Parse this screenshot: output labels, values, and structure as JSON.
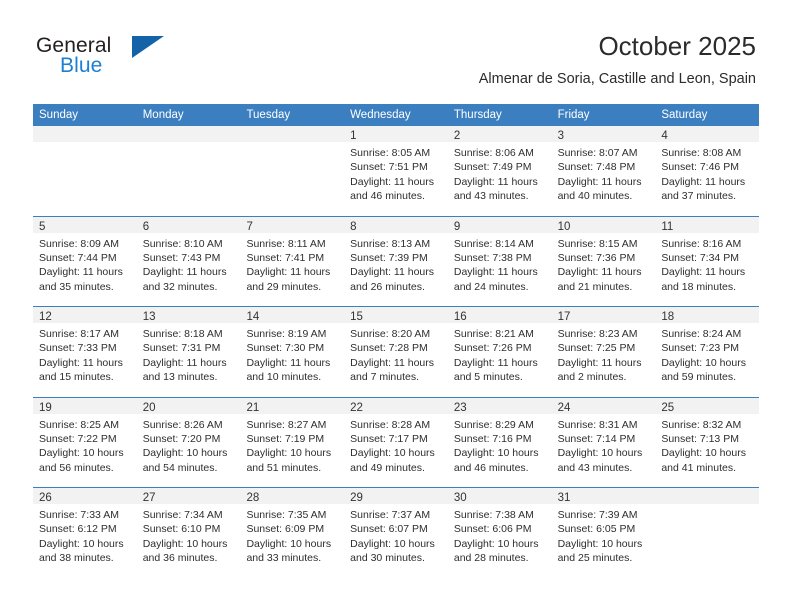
{
  "brand": {
    "name_top": "General",
    "name_bottom": "Blue",
    "color_dark": "#231f20",
    "color_blue": "#1c7fd4",
    "triangle_color": "#1463a8"
  },
  "header": {
    "title": "October 2025",
    "subtitle": "Almenar de Soria, Castille and Leon, Spain"
  },
  "calendar": {
    "header_bg": "#3c7fc1",
    "date_band_bg": "#f2f2f2",
    "row_separator": "#3c7fc1",
    "weekdays": [
      "Sunday",
      "Monday",
      "Tuesday",
      "Wednesday",
      "Thursday",
      "Friday",
      "Saturday"
    ],
    "weeks": [
      [
        {
          "empty": true
        },
        {
          "empty": true
        },
        {
          "empty": true
        },
        {
          "day": "1",
          "sunrise": "Sunrise: 8:05 AM",
          "sunset": "Sunset: 7:51 PM",
          "daylight": "Daylight: 11 hours and 46 minutes."
        },
        {
          "day": "2",
          "sunrise": "Sunrise: 8:06 AM",
          "sunset": "Sunset: 7:49 PM",
          "daylight": "Daylight: 11 hours and 43 minutes."
        },
        {
          "day": "3",
          "sunrise": "Sunrise: 8:07 AM",
          "sunset": "Sunset: 7:48 PM",
          "daylight": "Daylight: 11 hours and 40 minutes."
        },
        {
          "day": "4",
          "sunrise": "Sunrise: 8:08 AM",
          "sunset": "Sunset: 7:46 PM",
          "daylight": "Daylight: 11 hours and 37 minutes."
        }
      ],
      [
        {
          "day": "5",
          "sunrise": "Sunrise: 8:09 AM",
          "sunset": "Sunset: 7:44 PM",
          "daylight": "Daylight: 11 hours and 35 minutes."
        },
        {
          "day": "6",
          "sunrise": "Sunrise: 8:10 AM",
          "sunset": "Sunset: 7:43 PM",
          "daylight": "Daylight: 11 hours and 32 minutes."
        },
        {
          "day": "7",
          "sunrise": "Sunrise: 8:11 AM",
          "sunset": "Sunset: 7:41 PM",
          "daylight": "Daylight: 11 hours and 29 minutes."
        },
        {
          "day": "8",
          "sunrise": "Sunrise: 8:13 AM",
          "sunset": "Sunset: 7:39 PM",
          "daylight": "Daylight: 11 hours and 26 minutes."
        },
        {
          "day": "9",
          "sunrise": "Sunrise: 8:14 AM",
          "sunset": "Sunset: 7:38 PM",
          "daylight": "Daylight: 11 hours and 24 minutes."
        },
        {
          "day": "10",
          "sunrise": "Sunrise: 8:15 AM",
          "sunset": "Sunset: 7:36 PM",
          "daylight": "Daylight: 11 hours and 21 minutes."
        },
        {
          "day": "11",
          "sunrise": "Sunrise: 8:16 AM",
          "sunset": "Sunset: 7:34 PM",
          "daylight": "Daylight: 11 hours and 18 minutes."
        }
      ],
      [
        {
          "day": "12",
          "sunrise": "Sunrise: 8:17 AM",
          "sunset": "Sunset: 7:33 PM",
          "daylight": "Daylight: 11 hours and 15 minutes."
        },
        {
          "day": "13",
          "sunrise": "Sunrise: 8:18 AM",
          "sunset": "Sunset: 7:31 PM",
          "daylight": "Daylight: 11 hours and 13 minutes."
        },
        {
          "day": "14",
          "sunrise": "Sunrise: 8:19 AM",
          "sunset": "Sunset: 7:30 PM",
          "daylight": "Daylight: 11 hours and 10 minutes."
        },
        {
          "day": "15",
          "sunrise": "Sunrise: 8:20 AM",
          "sunset": "Sunset: 7:28 PM",
          "daylight": "Daylight: 11 hours and 7 minutes."
        },
        {
          "day": "16",
          "sunrise": "Sunrise: 8:21 AM",
          "sunset": "Sunset: 7:26 PM",
          "daylight": "Daylight: 11 hours and 5 minutes."
        },
        {
          "day": "17",
          "sunrise": "Sunrise: 8:23 AM",
          "sunset": "Sunset: 7:25 PM",
          "daylight": "Daylight: 11 hours and 2 minutes."
        },
        {
          "day": "18",
          "sunrise": "Sunrise: 8:24 AM",
          "sunset": "Sunset: 7:23 PM",
          "daylight": "Daylight: 10 hours and 59 minutes."
        }
      ],
      [
        {
          "day": "19",
          "sunrise": "Sunrise: 8:25 AM",
          "sunset": "Sunset: 7:22 PM",
          "daylight": "Daylight: 10 hours and 56 minutes."
        },
        {
          "day": "20",
          "sunrise": "Sunrise: 8:26 AM",
          "sunset": "Sunset: 7:20 PM",
          "daylight": "Daylight: 10 hours and 54 minutes."
        },
        {
          "day": "21",
          "sunrise": "Sunrise: 8:27 AM",
          "sunset": "Sunset: 7:19 PM",
          "daylight": "Daylight: 10 hours and 51 minutes."
        },
        {
          "day": "22",
          "sunrise": "Sunrise: 8:28 AM",
          "sunset": "Sunset: 7:17 PM",
          "daylight": "Daylight: 10 hours and 49 minutes."
        },
        {
          "day": "23",
          "sunrise": "Sunrise: 8:29 AM",
          "sunset": "Sunset: 7:16 PM",
          "daylight": "Daylight: 10 hours and 46 minutes."
        },
        {
          "day": "24",
          "sunrise": "Sunrise: 8:31 AM",
          "sunset": "Sunset: 7:14 PM",
          "daylight": "Daylight: 10 hours and 43 minutes."
        },
        {
          "day": "25",
          "sunrise": "Sunrise: 8:32 AM",
          "sunset": "Sunset: 7:13 PM",
          "daylight": "Daylight: 10 hours and 41 minutes."
        }
      ],
      [
        {
          "day": "26",
          "sunrise": "Sunrise: 7:33 AM",
          "sunset": "Sunset: 6:12 PM",
          "daylight": "Daylight: 10 hours and 38 minutes."
        },
        {
          "day": "27",
          "sunrise": "Sunrise: 7:34 AM",
          "sunset": "Sunset: 6:10 PM",
          "daylight": "Daylight: 10 hours and 36 minutes."
        },
        {
          "day": "28",
          "sunrise": "Sunrise: 7:35 AM",
          "sunset": "Sunset: 6:09 PM",
          "daylight": "Daylight: 10 hours and 33 minutes."
        },
        {
          "day": "29",
          "sunrise": "Sunrise: 7:37 AM",
          "sunset": "Sunset: 6:07 PM",
          "daylight": "Daylight: 10 hours and 30 minutes."
        },
        {
          "day": "30",
          "sunrise": "Sunrise: 7:38 AM",
          "sunset": "Sunset: 6:06 PM",
          "daylight": "Daylight: 10 hours and 28 minutes."
        },
        {
          "day": "31",
          "sunrise": "Sunrise: 7:39 AM",
          "sunset": "Sunset: 6:05 PM",
          "daylight": "Daylight: 10 hours and 25 minutes."
        },
        {
          "empty": true
        }
      ]
    ]
  }
}
